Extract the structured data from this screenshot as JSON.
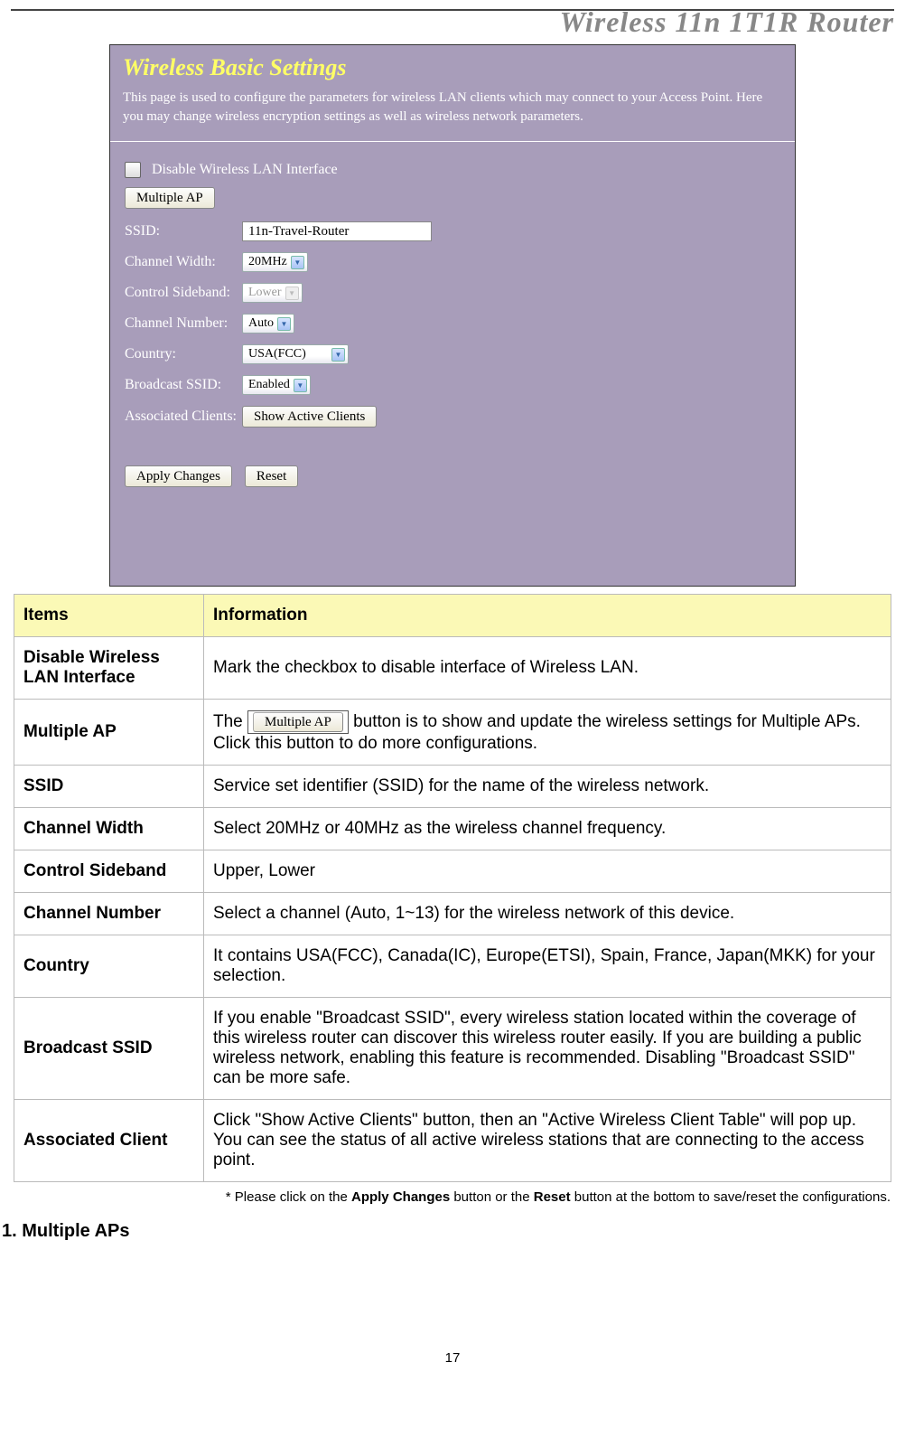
{
  "header": {
    "product_title": "Wireless 11n 1T1R Router"
  },
  "panel": {
    "title": "Wireless Basic Settings",
    "description": "This page is used to configure the parameters for wireless LAN clients which may connect to your Access Point. Here you may change wireless encryption settings as well as wireless network parameters.",
    "checkbox_label": "Disable Wireless LAN Interface",
    "multiple_ap_btn": "Multiple AP",
    "rows": {
      "ssid_label": "SSID:",
      "ssid_value": "11n-Travel-Router",
      "chw_label": "Channel Width:",
      "chw_value": "20MHz",
      "sb_label": "Control Sideband:",
      "sb_value": "Lower",
      "chn_label": "Channel Number:",
      "chn_value": "Auto",
      "country_label": "Country:",
      "country_value": "USA(FCC)",
      "bcast_label": "Broadcast SSID:",
      "bcast_value": "Enabled",
      "assoc_label": "Associated Clients:",
      "assoc_btn": "Show Active Clients"
    },
    "apply_btn": "Apply Changes",
    "reset_btn": "Reset"
  },
  "table": {
    "header_items": "Items",
    "header_info": "Information",
    "rows": [
      {
        "item": "Disable Wireless LAN Interface",
        "info": "Mark the checkbox to disable interface of Wireless LAN."
      },
      {
        "item": "Multiple AP",
        "info_before": "The ",
        "btn": "Multiple AP",
        "info_after": " button is to show and update the wireless settings for Multiple APs. Click this button to do more configurations."
      },
      {
        "item": "SSID",
        "info": "Service set identifier (SSID) for the name of the wireless network."
      },
      {
        "item": "Channel Width",
        "info": "Select 20MHz or 40MHz as the wireless channel frequency."
      },
      {
        "item": "Control Sideband",
        "info": "Upper, Lower"
      },
      {
        "item": "Channel Number",
        "info": "Select a channel (Auto, 1~13) for the wireless network of this device."
      },
      {
        "item": "Country",
        "info": "It contains USA(FCC), Canada(IC), Europe(ETSI), Spain, France, Japan(MKK) for your selection."
      },
      {
        "item": "Broadcast SSID",
        "info": "If you enable \"Broadcast SSID\", every wireless station located within the coverage of this wireless router can discover this wireless router easily. If you are building a public wireless network, enabling this feature is recommended. Disabling \"Broadcast SSID\" can be more safe."
      },
      {
        "item": "Associated Client",
        "info": "Click \"Show Active Clients\" button, then an \"Active Wireless Client Table\" will pop up. You can see the status of all active wireless stations that are connecting to the access point."
      }
    ]
  },
  "footnote": {
    "pre": "* Please click on the ",
    "b1": "Apply Changes",
    "mid": " button or the ",
    "b2": "Reset",
    "post": " button at the bottom to save/reset the configurations."
  },
  "section1": "1. Multiple APs",
  "page_number": "17"
}
